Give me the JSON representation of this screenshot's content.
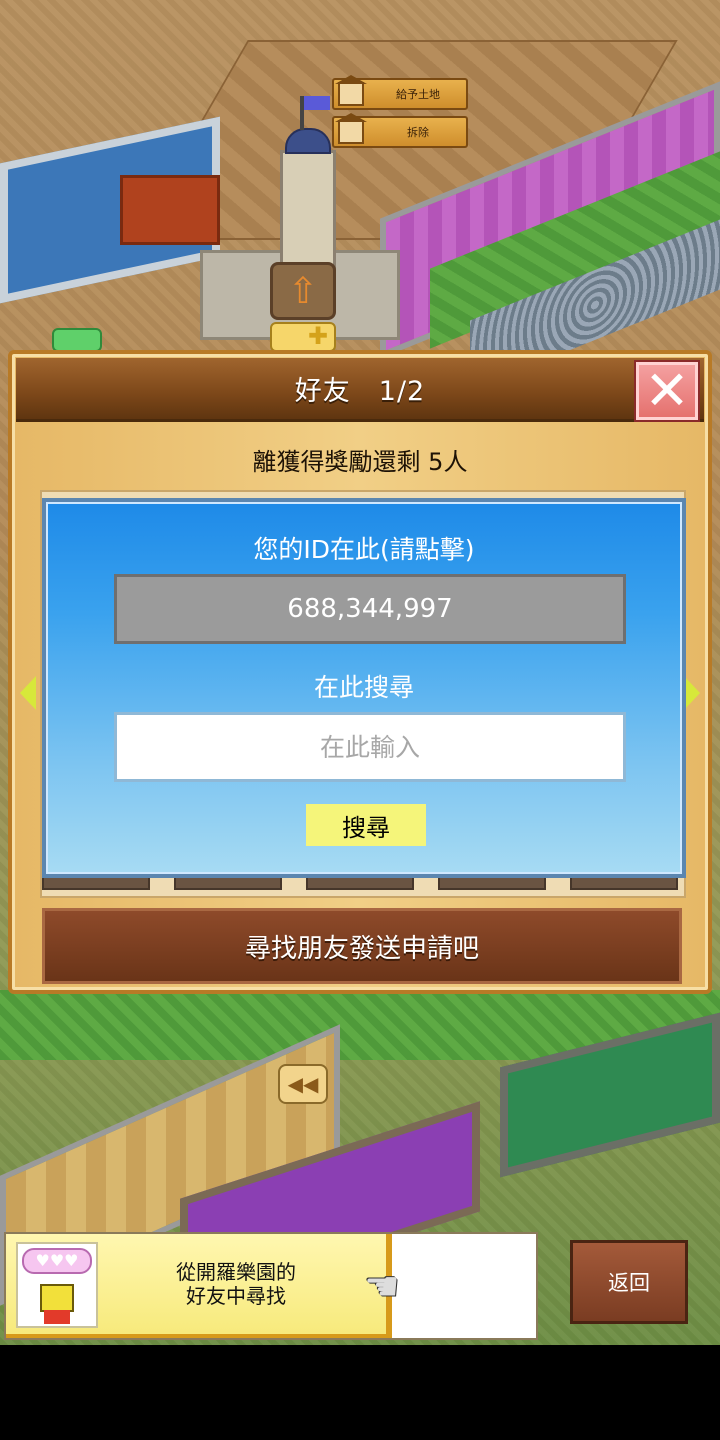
{
  "map": {
    "sign_give_land": "給予土地",
    "sign_demolish": "拆除"
  },
  "dialog": {
    "title": "好友　1/2",
    "reward_text": "離獲得獎勵還剩 5人",
    "id_label": "您的ID在此(請點擊)",
    "id_value": "688,344,997",
    "search_label": "在此搜尋",
    "search_placeholder": "在此輸入",
    "search_button": "搜尋",
    "send_request_button": "尋找朋友發送申請吧"
  },
  "hint": {
    "text_line1": "從開羅樂園的",
    "text_line2": "好友中尋找",
    "hearts": "♥♥♥"
  },
  "back_button": "返回",
  "colors": {
    "title_bar": "#7c4719",
    "panel_blue": "#3aa2ee",
    "search_button": "#f5f57a",
    "close_button": "#e5716e",
    "nav_arrow": "#d7e83a"
  },
  "icons": {
    "close": "close-icon",
    "prev": "arrow-left-icon",
    "next": "arrow-right-icon",
    "hand": "pointing-hand-icon",
    "mascot": "mascot-icon",
    "upgrade": "upgrade-arrow-icon"
  }
}
